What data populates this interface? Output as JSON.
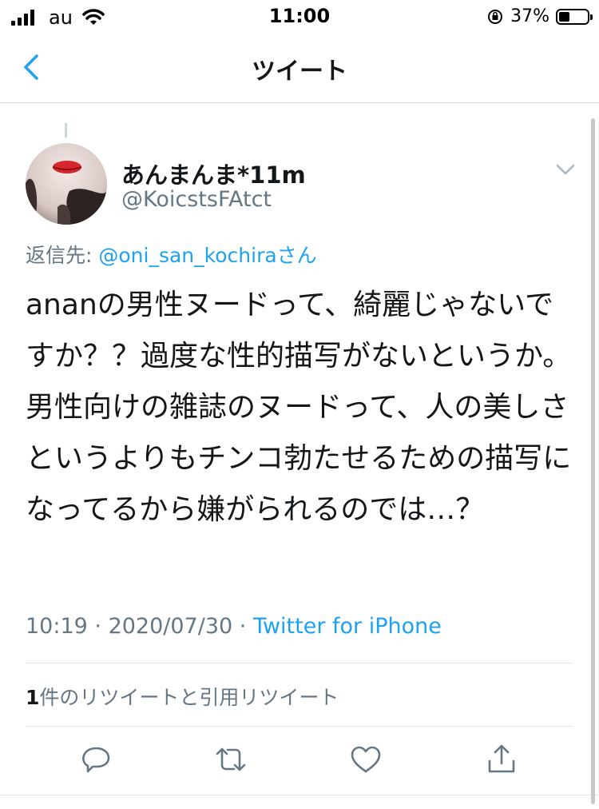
{
  "status_bar": {
    "carrier": "au",
    "time": "11:00",
    "battery_percent": "37%",
    "battery_level": 0.37
  },
  "nav": {
    "title": "ツイート",
    "back_icon": "chevron-left-icon"
  },
  "tweet": {
    "display_name": "あんまんま*11m",
    "handle": "@KoicstsFAtct",
    "reply_prefix": "返信先: ",
    "reply_mention": "@oni_san_kochira",
    "reply_suffix": "さん",
    "text": "ananの男性ヌードって、綺麗じゃないですか？？過度な性的描写がないというか。男性向けの雑誌のヌードって、人の美しさというよりもチンコ勃たせるための描写になってるから嫌がられるのでは…？",
    "time": "10:19",
    "date": "2020/07/30",
    "source": "Twitter for iPhone",
    "retweet_count": "1",
    "retweet_label": "件のリツイートと引用リツイート"
  },
  "actions": [
    "reply-icon",
    "retweet-icon",
    "like-icon",
    "share-icon"
  ],
  "colors": {
    "link": "#1da1f2",
    "secondary_text": "#657786",
    "primary_text": "#14171a",
    "divider": "#e1e8ed"
  }
}
